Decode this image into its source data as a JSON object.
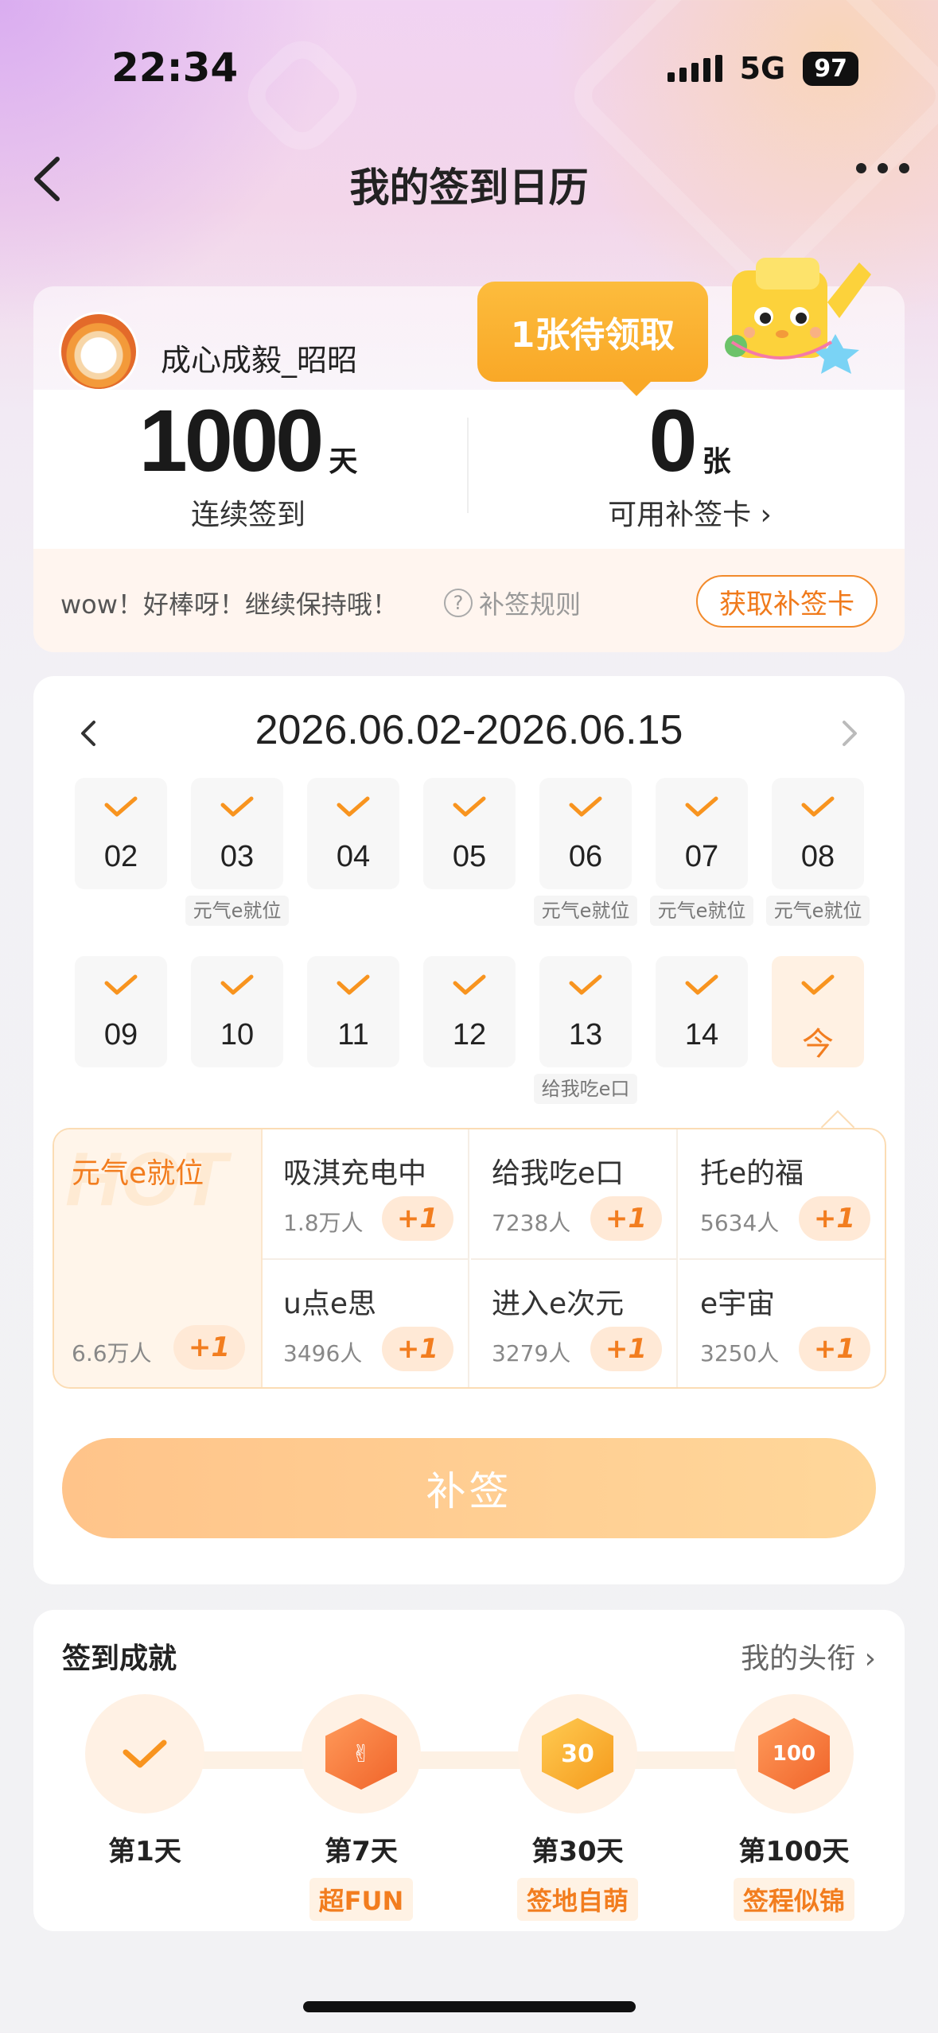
{
  "status_bar": {
    "time": "22:34",
    "network": "5G",
    "battery": "97"
  },
  "nav": {
    "title": "我的签到日历"
  },
  "profile": {
    "username": "成心成毅_昭昭",
    "streak_value": "1000",
    "streak_unit": "天",
    "streak_label": "连续签到",
    "cards_value": "0",
    "cards_unit": "张",
    "cards_label": "可用补签卡 ›",
    "pending_badge": "1张待领取",
    "tip": "wow！好棒呀！继续保持哦！",
    "rule_link": "补签规则",
    "get_card_button": "获取补签卡"
  },
  "calendar": {
    "range": "2026.06.02-2026.06.15",
    "week1": [
      {
        "day": "02",
        "tag": ""
      },
      {
        "day": "03",
        "tag": "元气e就位"
      },
      {
        "day": "04",
        "tag": ""
      },
      {
        "day": "05",
        "tag": ""
      },
      {
        "day": "06",
        "tag": "元气e就位"
      },
      {
        "day": "07",
        "tag": "元气e就位"
      },
      {
        "day": "08",
        "tag": "元气e就位"
      }
    ],
    "week2": [
      {
        "day": "09",
        "tag": ""
      },
      {
        "day": "10",
        "tag": ""
      },
      {
        "day": "11",
        "tag": ""
      },
      {
        "day": "12",
        "tag": ""
      },
      {
        "day": "13",
        "tag": "给我吃e口"
      },
      {
        "day": "14",
        "tag": ""
      },
      {
        "day": "今",
        "tag": ""
      }
    ]
  },
  "statuses": {
    "featured": {
      "name": "元气e就位",
      "count": "6.6万人",
      "plus": "+1",
      "watermark": "HOT"
    },
    "items": [
      {
        "name": "吸淇充电中",
        "count": "1.8万人",
        "plus": "+1"
      },
      {
        "name": "给我吃e口",
        "count": "7238人",
        "plus": "+1"
      },
      {
        "name": "托e的福",
        "count": "5634人",
        "plus": "+1"
      },
      {
        "name": "u点e思",
        "count": "3496人",
        "plus": "+1"
      },
      {
        "name": "进入e次元",
        "count": "3279人",
        "plus": "+1"
      },
      {
        "name": "e宇宙",
        "count": "3250人",
        "plus": "+1"
      }
    ]
  },
  "makeup_button": "补签",
  "achievements": {
    "title": "签到成就",
    "link": "我的头衔 ›",
    "items": [
      {
        "day": "第1天",
        "badge": ""
      },
      {
        "day": "第7天",
        "badge": "超FUN"
      },
      {
        "day": "第30天",
        "badge": "签地自萌"
      },
      {
        "day": "第100天",
        "badge": "签程似锦"
      }
    ],
    "icon_30": "30",
    "icon_100": "100"
  },
  "colors": {
    "accent": "#f27d1f",
    "badge": "#f9a827",
    "button": "#ffc48a"
  }
}
